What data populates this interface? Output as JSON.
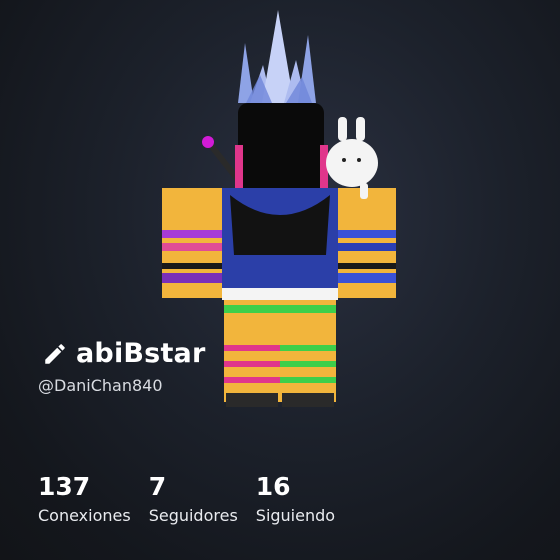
{
  "profile": {
    "display_name": "abiBstar",
    "username": "@DaniChan840",
    "edit_icon": "pencil-icon",
    "stats": [
      {
        "value": "137",
        "label": "Conexiones"
      },
      {
        "value": "7",
        "label": "Seguidores"
      },
      {
        "value": "16",
        "label": "Siguiendo"
      }
    ]
  },
  "colors": {
    "background": "#1a1e26",
    "text": "#ffffff",
    "subtext": "#d9dce2"
  }
}
